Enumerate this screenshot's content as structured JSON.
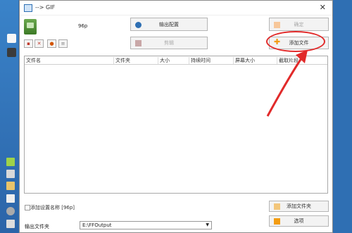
{
  "window": {
    "title": "--> GIF"
  },
  "preset": {
    "name": "96p"
  },
  "buttons": {
    "output_config": "输出配置",
    "ok": "确定",
    "add_file": "添加文件",
    "clip": "剪辑",
    "add_folder": "添加文件夹",
    "options": "选项"
  },
  "table": {
    "headers": [
      "文件名",
      "文件夹",
      "大小",
      "持续时间",
      "屏幕大小",
      "截取片段"
    ]
  },
  "checkbox": {
    "label": "添加设置名称 [96p]"
  },
  "output": {
    "label": "输出文件夹",
    "path": "E:\\FFOutput"
  },
  "colors": {
    "highlight": "#e12a2a",
    "accent_orange": "#f39c12"
  }
}
